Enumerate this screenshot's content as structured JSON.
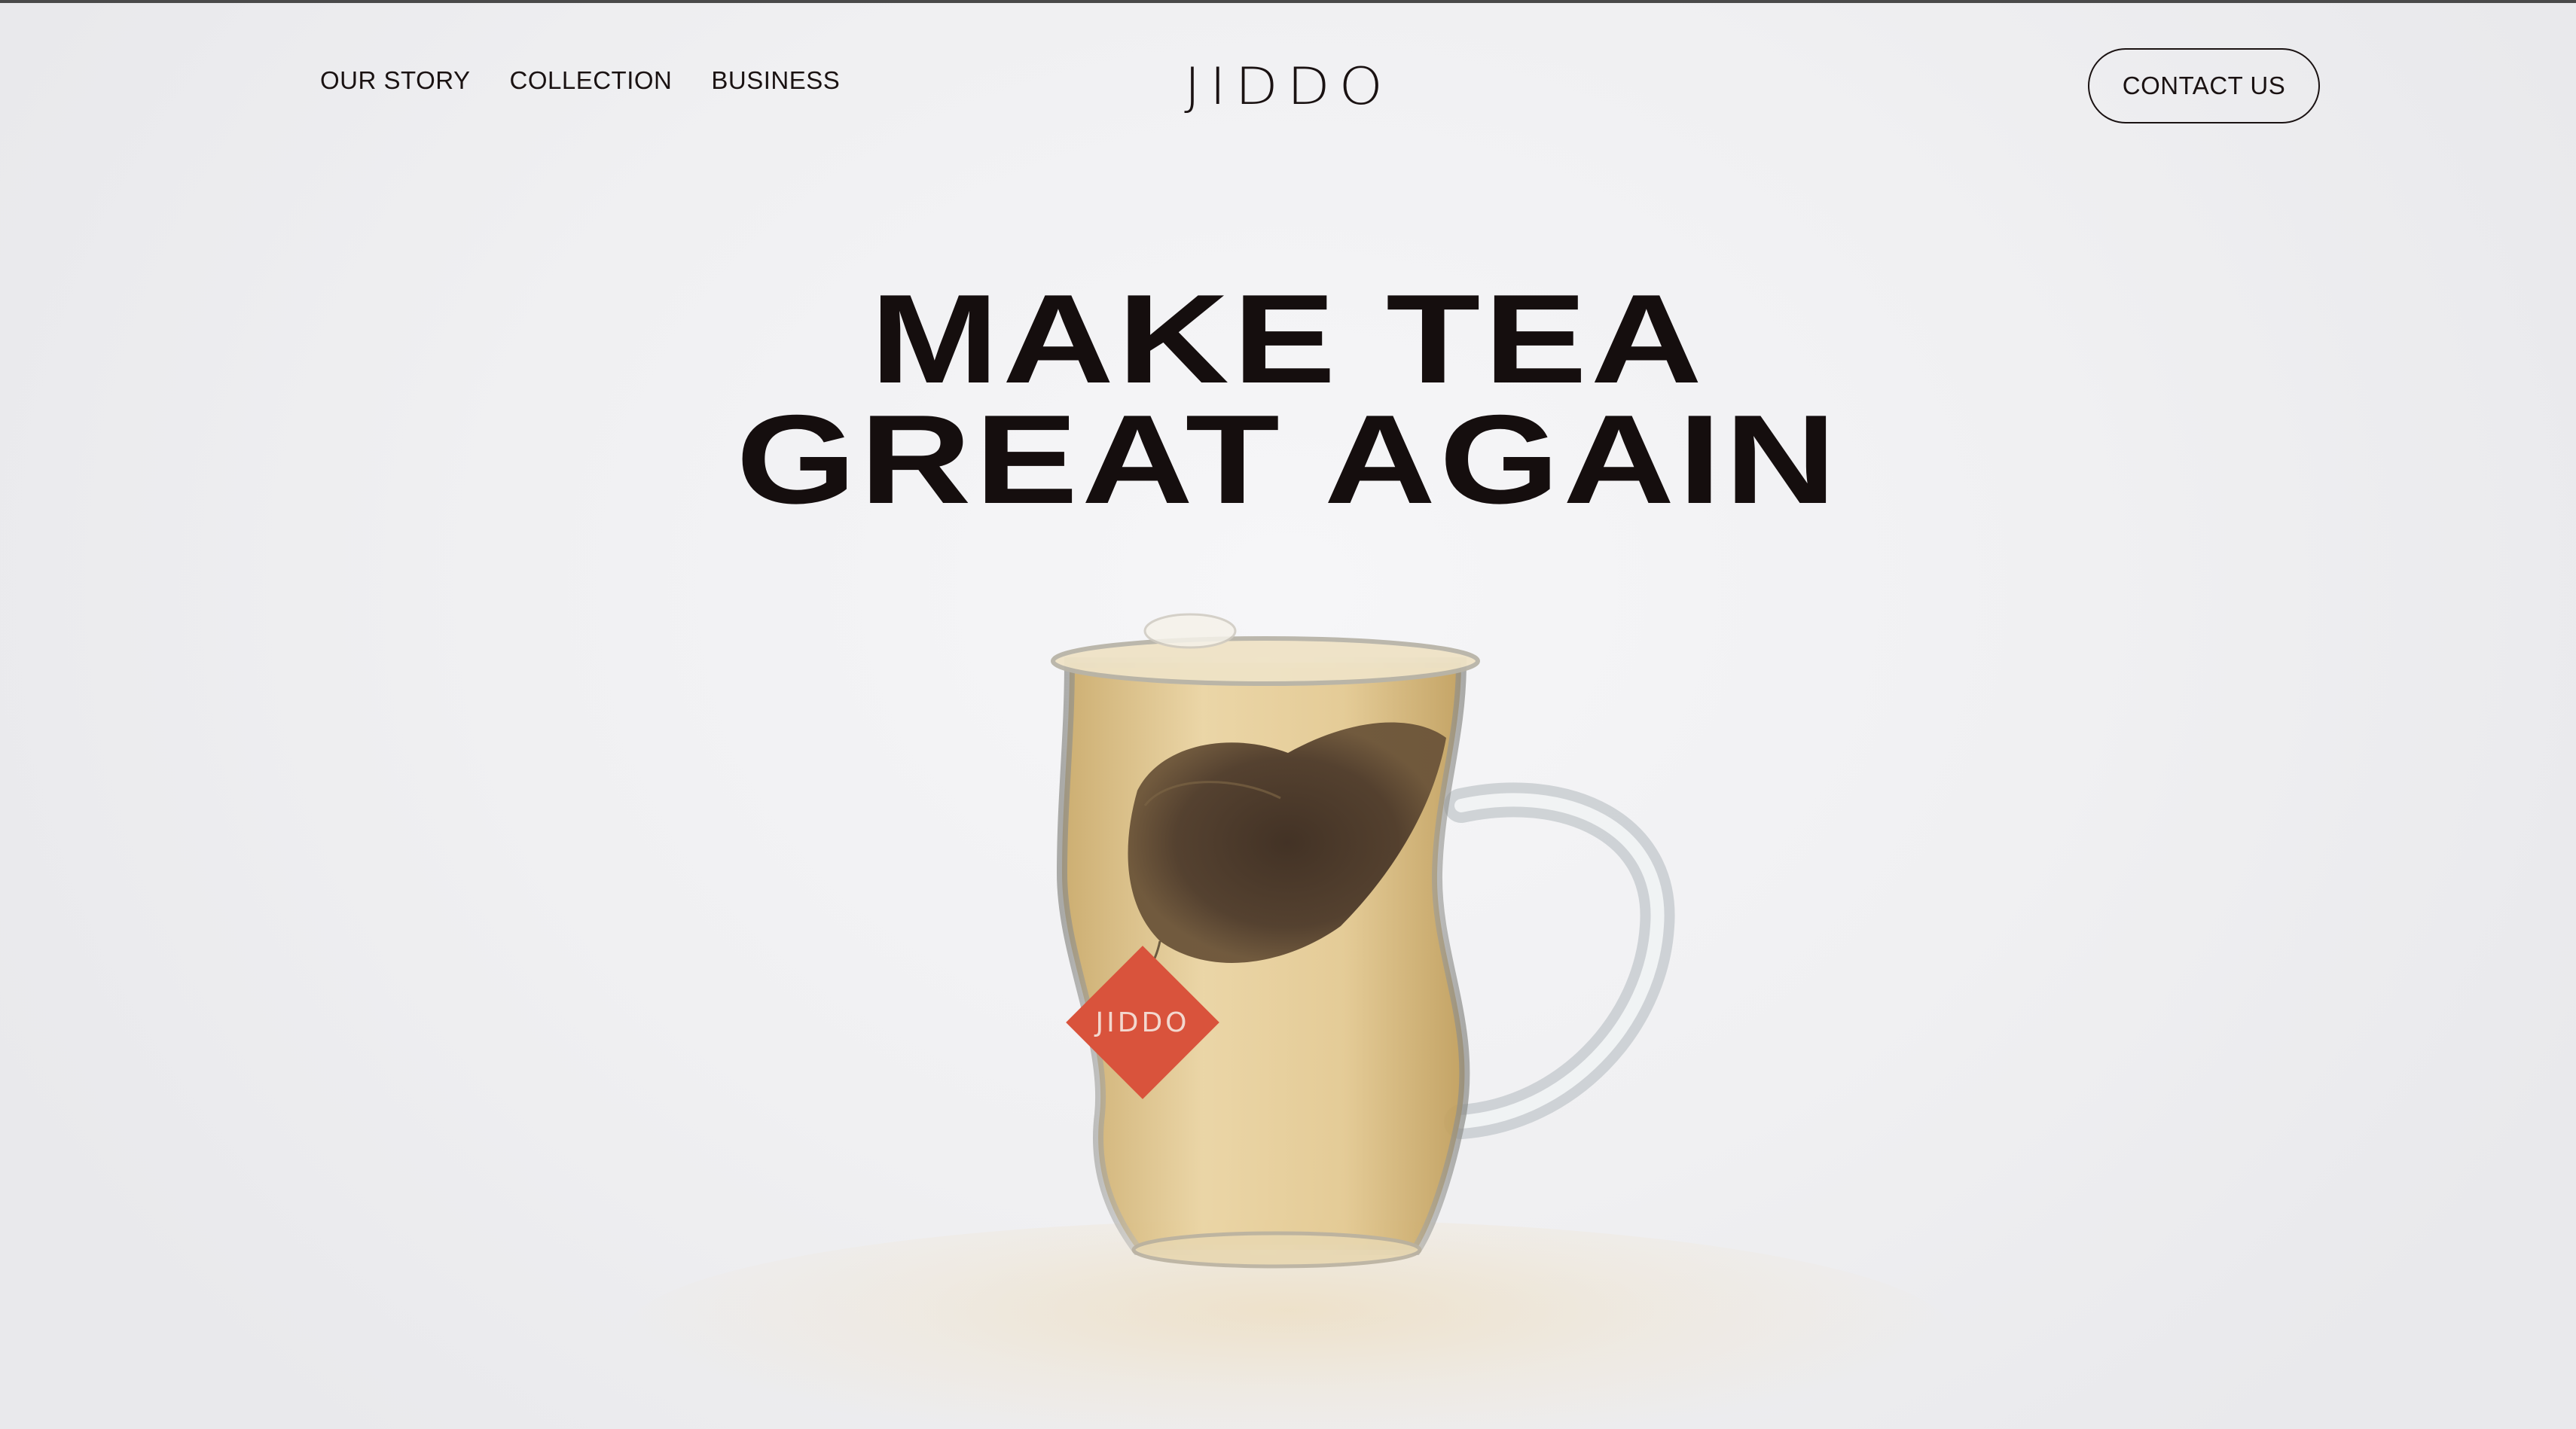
{
  "nav": {
    "items": [
      "OUR STORY",
      "COLLECTION",
      "BUSINESS"
    ]
  },
  "brand": {
    "logo_text": "JIDDO",
    "tag_text": "JIDDO",
    "tag_color": "#d9533c"
  },
  "header": {
    "contact_label": "CONTACT US"
  },
  "hero": {
    "line1": "MAKE TEA",
    "line2": "GREAT AGAIN"
  },
  "icons": {
    "hero_image": "tea-glass-with-tea-bag"
  }
}
